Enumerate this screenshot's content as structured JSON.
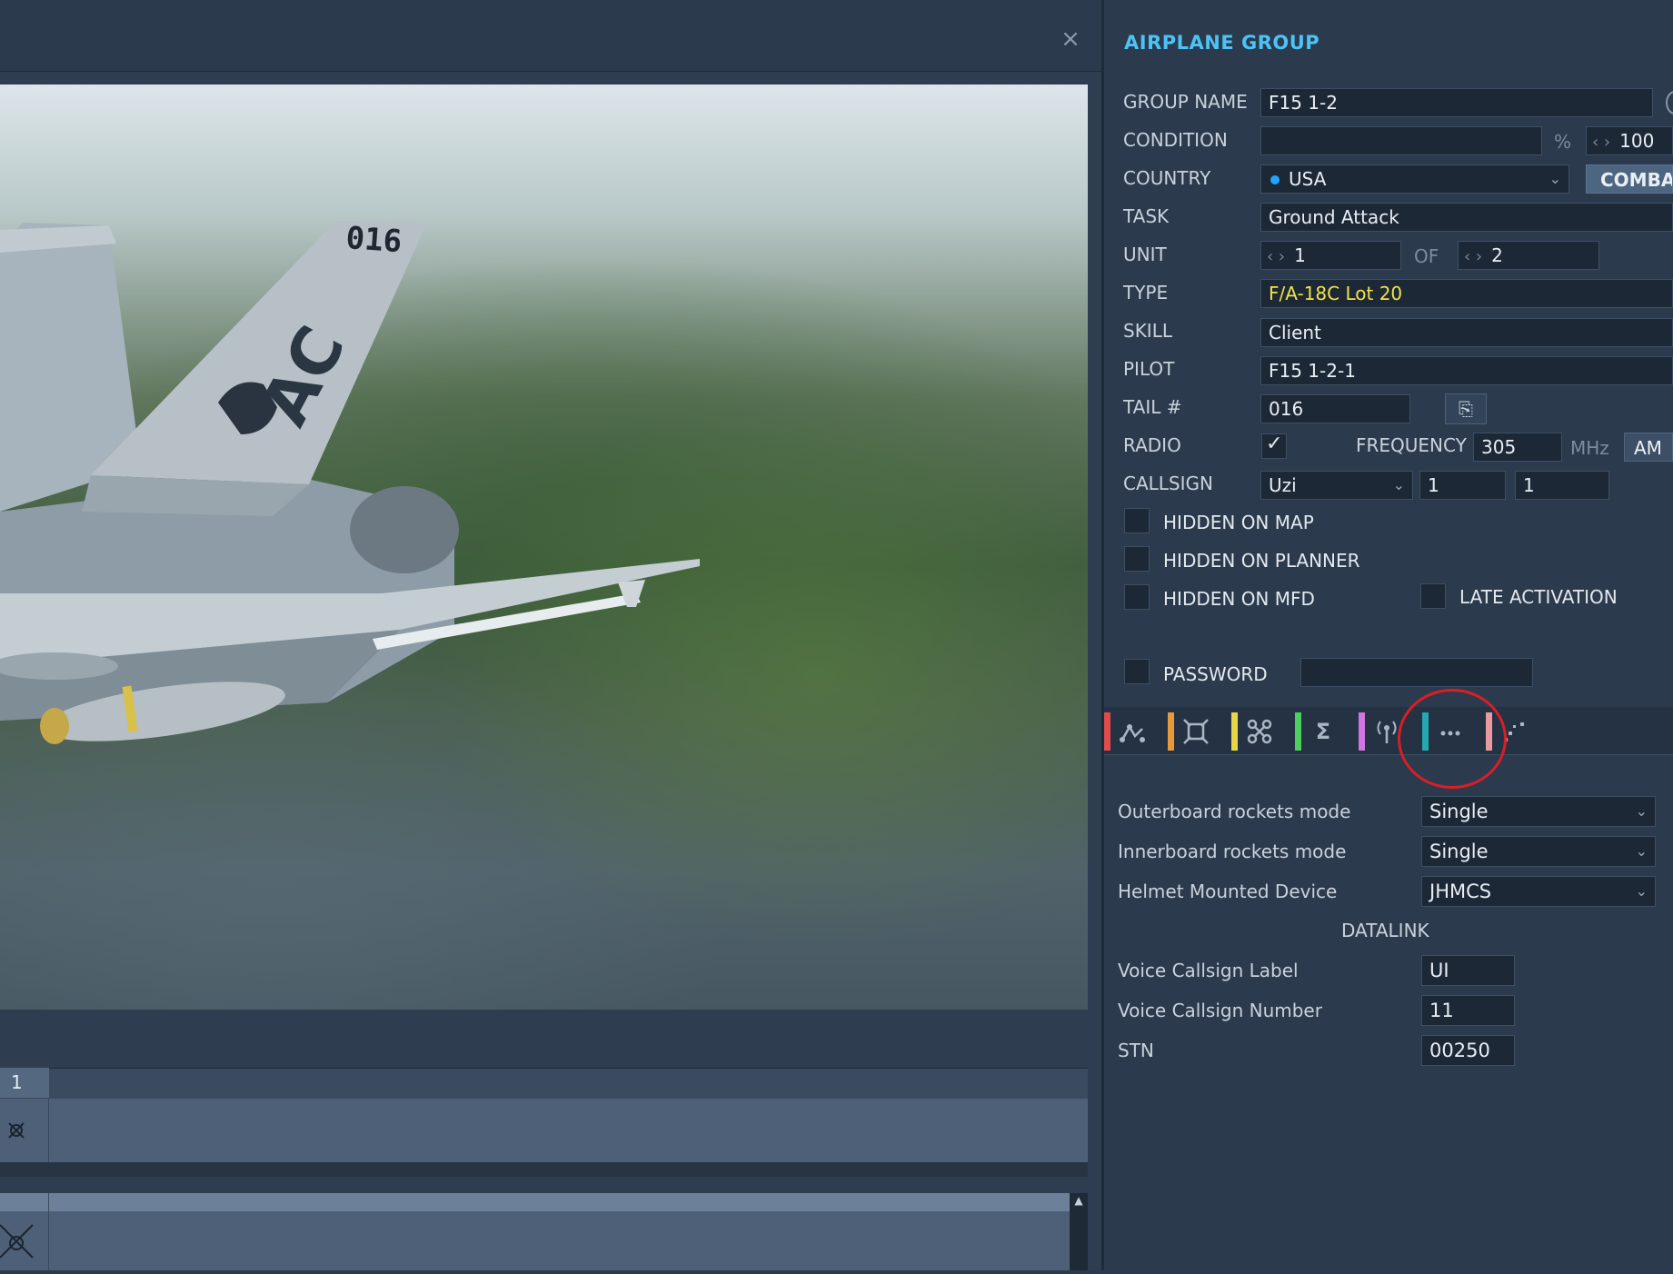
{
  "window": {
    "close_glyph": "×"
  },
  "panel": {
    "title": "AIRPLANE GROUP",
    "labels": {
      "group_name": "GROUP NAME",
      "condition": "CONDITION",
      "country": "COUNTRY",
      "task": "TASK",
      "unit": "UNIT",
      "type": "TYPE",
      "skill": "SKILL",
      "pilot": "PILOT",
      "tail": "TAIL #",
      "radio": "RADIO",
      "frequency": "FREQUENCY",
      "callsign": "CALLSIGN",
      "of": "OF",
      "percent": "%",
      "mhz": "MHz"
    },
    "values": {
      "group_name": "F15 1-2",
      "condition": "",
      "condition_pct": "100",
      "country": "USA",
      "combat_button": "COMBAT",
      "task": "Ground Attack",
      "unit": "1",
      "unit_of": "2",
      "type": "F/A-18C Lot 20",
      "skill": "Client",
      "pilot": "F15 1-2-1",
      "tail": "016",
      "radio_checked": true,
      "frequency": "305",
      "modulation": "AM",
      "callsign_name": "Uzi",
      "callsign_group": "1",
      "callsign_unit": "1",
      "password": ""
    },
    "checkboxes": {
      "hidden_on_map": "HIDDEN ON MAP",
      "hidden_on_planner": "HIDDEN ON PLANNER",
      "hidden_on_mfd": "HIDDEN ON MFD",
      "late_activation": "LATE ACTIVATION",
      "password": "PASSWORD"
    },
    "country_dot_color": "#21a4ff",
    "tabs": [
      {
        "name": "route",
        "icon": "route-icon",
        "color": "#e14b4b",
        "glyph": "⌒"
      },
      {
        "name": "unit",
        "icon": "target-icon",
        "color": "#e69a3a",
        "glyph": "⌑"
      },
      {
        "name": "payload",
        "icon": "payload-icon",
        "color": "#e8d64a",
        "glyph": "⌘"
      },
      {
        "name": "summary",
        "icon": "sigma-icon",
        "color": "#4ccf5f",
        "glyph": "Σ"
      },
      {
        "name": "radio",
        "icon": "antenna-icon",
        "color": "#d076e0",
        "glyph": "((•))"
      },
      {
        "name": "additional",
        "icon": "more-dots-icon",
        "color": "#24a8b4",
        "glyph": "•••"
      },
      {
        "name": "failures",
        "icon": "failures-icon",
        "color": "#e89aa0",
        "glyph": "⋰"
      }
    ],
    "props": {
      "outboard_label": "Outerboard rockets mode",
      "outboard_value": "Single",
      "inboard_label": "Innerboard rockets mode",
      "inboard_value": "Single",
      "helmet_label": "Helmet Mounted Device",
      "helmet_value": "JHMCS",
      "datalink_header": "DATALINK",
      "voice_label_label": "Voice Callsign Label",
      "voice_label_value": "UI",
      "voice_number_label": "Voice Callsign Number",
      "voice_number_value": "11",
      "stn_label": "STN",
      "stn_value": "00250"
    }
  },
  "preview": {
    "tail_number": "016",
    "tail_letters": "AC"
  },
  "timeline": {
    "row_number": "1"
  }
}
